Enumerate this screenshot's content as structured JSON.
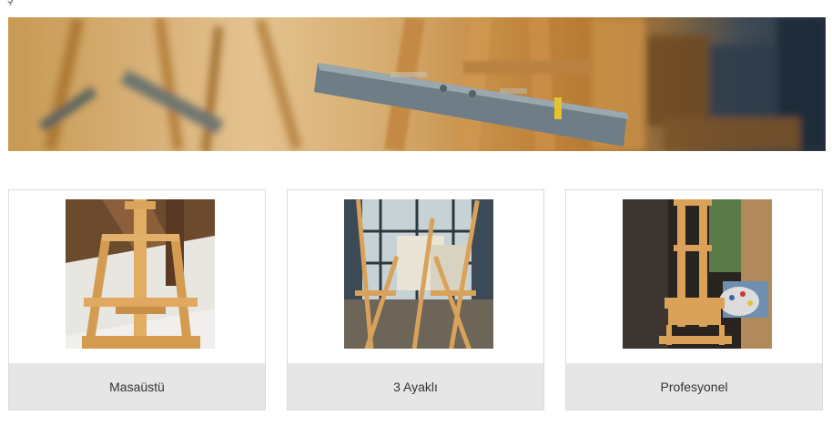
{
  "top_fragment": "ş",
  "banner": {
    "icon": "easel-photo-banner"
  },
  "categories": [
    {
      "label": "Masaüstü",
      "icon": "tabletop-easel-photo"
    },
    {
      "label": "3 Ayaklı",
      "icon": "tripod-easel-photo"
    },
    {
      "label": "Profesyonel",
      "icon": "studio-easel-photo"
    }
  ],
  "colors": {
    "caption_bg": "#e6e6e6",
    "card_border": "#dcdcdc",
    "wood": "#d8a25a"
  }
}
